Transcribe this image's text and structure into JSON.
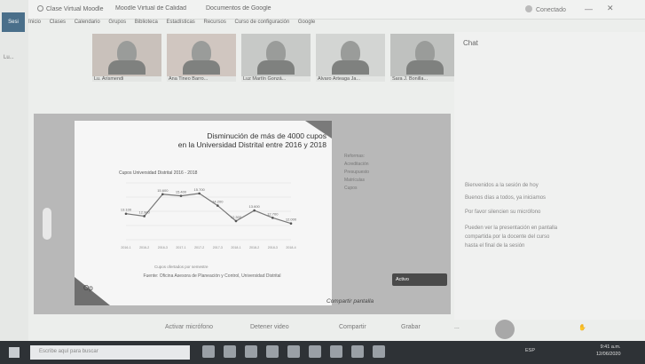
{
  "left_strip": {
    "tab_label": "Sesi",
    "mini_text": "Lu..."
  },
  "browser": {
    "tabs": [
      "Clase Virtual Moodle",
      "Moodle Virtual de Calidad",
      "Documentos de Google"
    ],
    "profile": "Conectado",
    "bookmarks": [
      "Inicio",
      "Clases",
      "Calendario",
      "Grupos",
      "Biblioteca",
      "Estadísticas",
      "Recursos",
      "Curso de configuración",
      "Google"
    ]
  },
  "participants": [
    {
      "name": "Lu. Arismendi"
    },
    {
      "name": "Ana Tineo Barro..."
    },
    {
      "name": "Luz Martín Gonzá..."
    },
    {
      "name": "Alvaro Arteaga Ja..."
    },
    {
      "name": "Sara J. Bonilla..."
    }
  ],
  "right_panel": {
    "header": "Chat",
    "lines": [
      "Bienvenidos a la sesión de hoy",
      "Buenos días a todos, ya iniciamos",
      "Por favor silencien su micrófono",
      "Pueden ver la presentación en pantalla",
      "compartida por la docente del curso",
      "hasta el final de la sesión"
    ]
  },
  "slide": {
    "title_line1": "Disminución de más de 4000 cupos",
    "title_line2": "en la Universidad Distrital entre 2016 y 2018",
    "chart_title": "Cupos Universidad Distrital 2016 - 2018",
    "caption": "Fuente: Oficina Asesora de Planeación y Control, Universidad Distrital",
    "legend": "Cupos ofertados por semestre",
    "logo": "Op",
    "side_text": [
      "Reformas:",
      "Acreditación",
      "Presupuesto",
      "Matrículas",
      "Cupos"
    ],
    "note": "Compartir pantalla",
    "share_chip": "Activo"
  },
  "chart_data": {
    "type": "line",
    "title": "Cupos Universidad Distrital 2016 - 2018",
    "categories": [
      "2016-1",
      "2016-2",
      "2016-3",
      "2017-1",
      "2017-2",
      "2017-3",
      "2018-1",
      "2018-2",
      "2018-3",
      "2018-4"
    ],
    "series": [
      {
        "name": "Cupos",
        "values": [
          13200,
          12900,
          15600,
          15400,
          15700,
          14200,
          12300,
          13600,
          12700,
          12000
        ]
      }
    ],
    "ylim": [
      10000,
      17000
    ],
    "data_labels": [
      "13.100",
      "12.900",
      "15.600",
      "15.400",
      "15.700",
      "14.200",
      "12.300",
      "13.600",
      "12.700",
      "12.000"
    ]
  },
  "meeting_bar": {
    "mic": "Activar micrófono",
    "cam": "Detener video",
    "share": "Compartir",
    "rec": "Grabar",
    "more": "..."
  },
  "taskbar": {
    "search": "Escribe aquí para buscar",
    "tray": "ESP",
    "time": "9:41 a.m.",
    "date": "12/06/2020"
  }
}
